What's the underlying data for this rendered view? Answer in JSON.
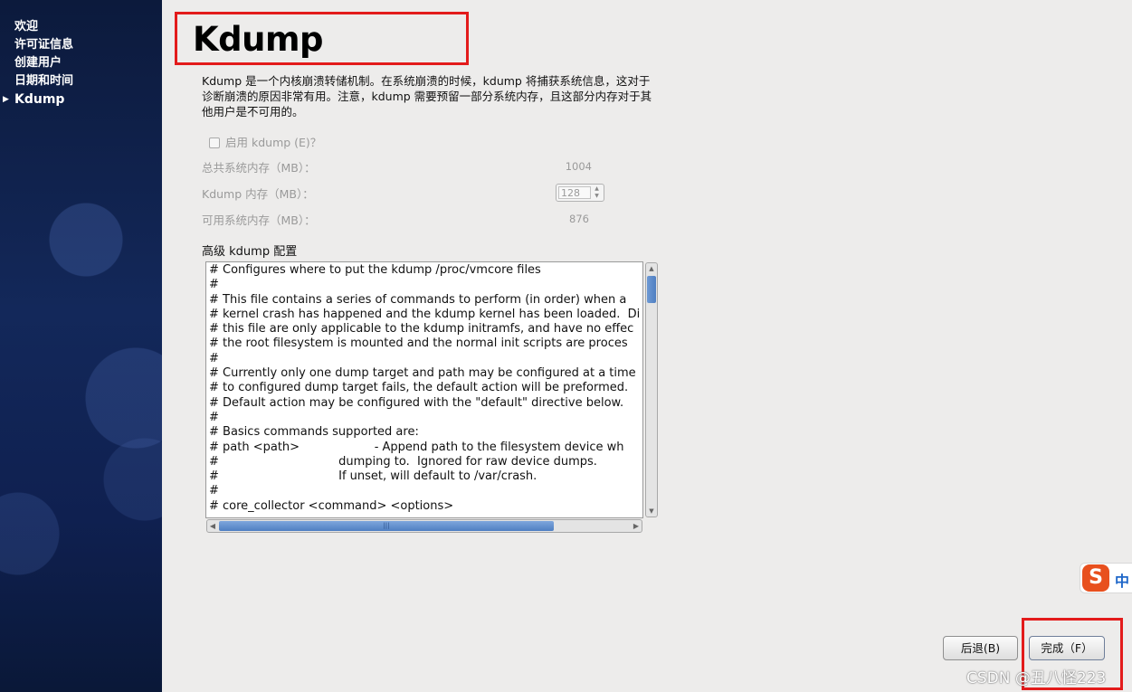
{
  "sidebar": {
    "items": [
      {
        "label": "欢迎"
      },
      {
        "label": "许可证信息"
      },
      {
        "label": "创建用户"
      },
      {
        "label": "日期和时间"
      },
      {
        "label": "Kdump",
        "active": true
      }
    ]
  },
  "header": {
    "title": "Kdump"
  },
  "description": "Kdump 是一个内核崩溃转储机制。在系统崩溃的时候，kdump 将捕获系统信息，这对于诊断崩溃的原因非常有用。注意，kdump 需要预留一部分系统内存，且这部分内存对于其他用户是不可用的。",
  "enable": {
    "label": "启用 kdump (E)？",
    "checked": false
  },
  "memory": {
    "total_label": "总共系统内存（MB）：",
    "total_value": "1004",
    "kdump_label": "Kdump 内存（MB）：",
    "kdump_value": "128",
    "usable_label": "可用系统内存（MB）：",
    "usable_value": "876"
  },
  "advanced": {
    "label": "高级 kdump 配置",
    "config_text": "# Configures where to put the kdump /proc/vmcore files\n#\n# This file contains a series of commands to perform (in order) when a\n# kernel crash has happened and the kdump kernel has been loaded.  Di\n# this file are only applicable to the kdump initramfs, and have no effec\n# the root filesystem is mounted and the normal init scripts are proces\n#\n# Currently only one dump target and path may be configured at a time\n# to configured dump target fails, the default action will be preformed.\n# Default action may be configured with the \"default\" directive below.\n#\n# Basics commands supported are:\n# path <path>                    - Append path to the filesystem device wh\n#                                dumping to.  Ignored for raw device dumps.\n#                                If unset, will default to /var/crash.\n#\n# core_collector <command> <options>"
  },
  "buttons": {
    "back": "后退(B)",
    "finish": "完成（F）"
  },
  "ime": {
    "logo": "S",
    "mode": "中"
  },
  "watermark": "CSDN @丑八怪223",
  "colors": {
    "highlight_box": "#e31b1b",
    "scroll_thumb": "#4f7fc2",
    "ime_brand": "#e8501e"
  }
}
